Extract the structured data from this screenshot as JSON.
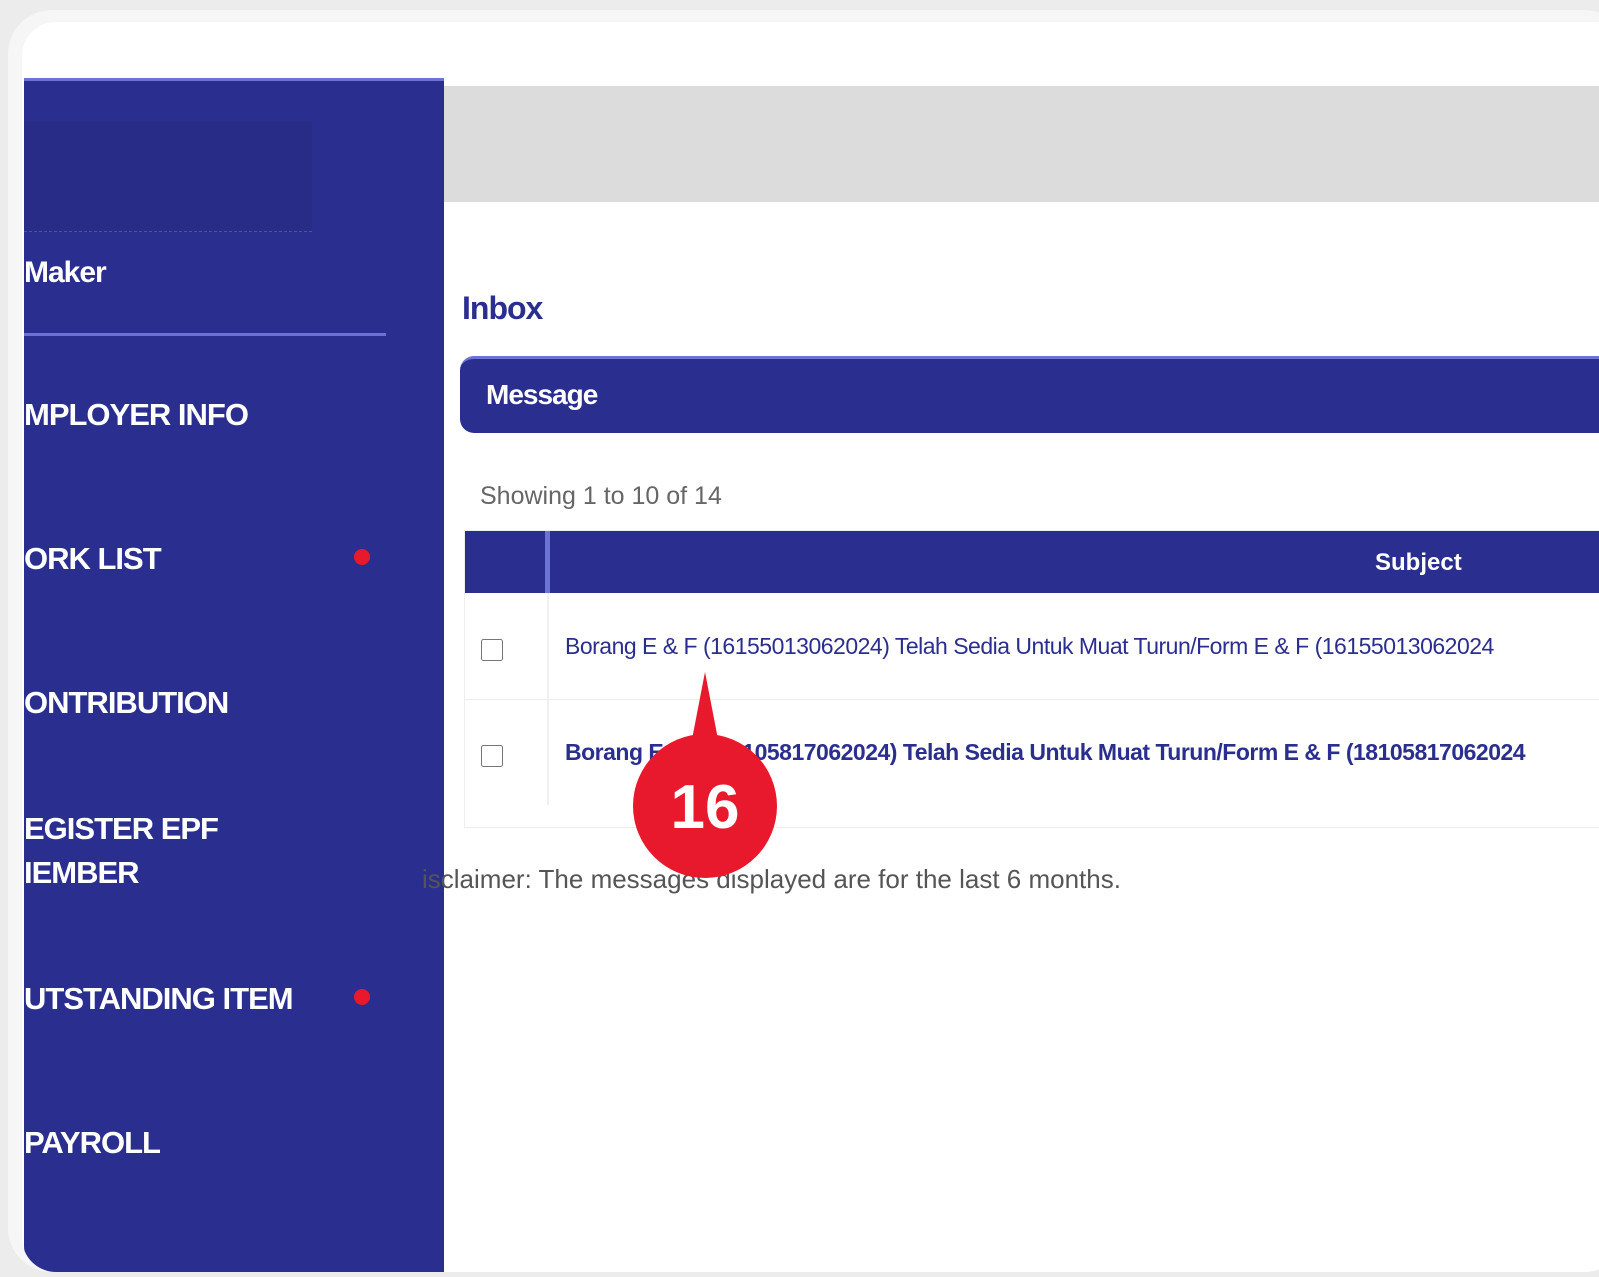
{
  "sidebar": {
    "role": "Maker",
    "items": [
      {
        "label": "MPLOYER INFO",
        "dot": false
      },
      {
        "label": "ORK LIST",
        "dot": true
      },
      {
        "label": "ONTRIBUTION",
        "dot": false
      },
      {
        "label": "EGISTER EPF",
        "label2": "IEMBER",
        "dot": false
      },
      {
        "label": "UTSTANDING ITEM",
        "dot": true
      },
      {
        "label": "PAYROLL",
        "dot": false
      }
    ]
  },
  "main": {
    "title": "Inbox",
    "panel_label": "Message",
    "showing": "Showing 1 to 10 of 14",
    "column_subject": "Subject",
    "rows": [
      {
        "subject": "Borang E & F (16155013062024) Telah Sedia Untuk Muat Turun/Form E & F (16155013062024"
      },
      {
        "subject": "Borang E & F (18105817062024) Telah Sedia Untuk Muat Turun/Form E & F (18105817062024"
      }
    ],
    "disclaimer": "isclaimer: The messages displayed are for the last 6 months."
  },
  "callout": {
    "number": "16",
    "color": "#e8192c"
  },
  "colors": {
    "brand": "#2a2e8e",
    "accent": "#6b73d4",
    "alert": "#e8192c"
  }
}
